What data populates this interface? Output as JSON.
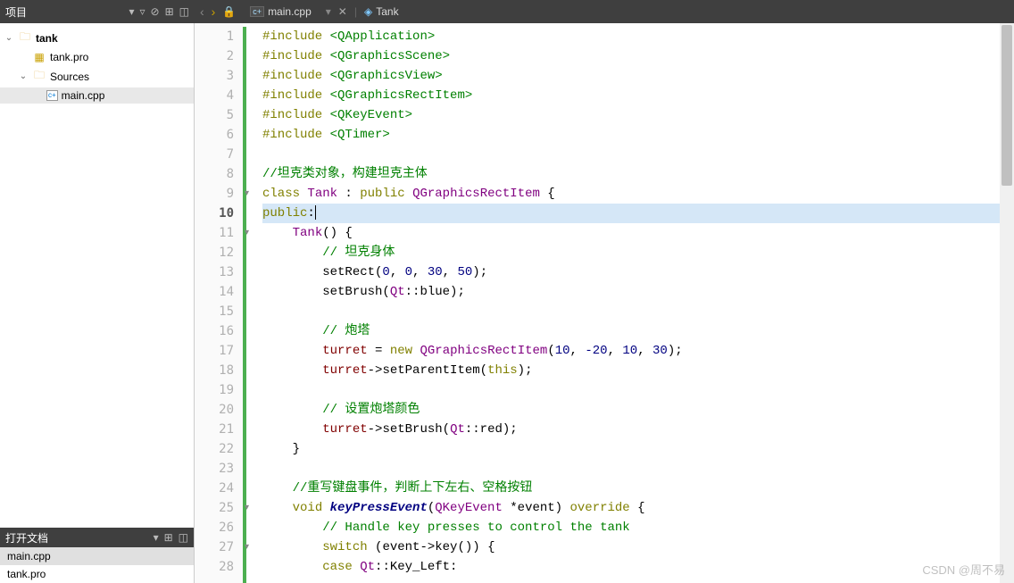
{
  "sidebar": {
    "project_label": "项目",
    "tree": {
      "root": "tank",
      "pro_file": "tank.pro",
      "sources_label": "Sources",
      "main_file": "main.cpp"
    },
    "open_docs_label": "打开文档",
    "open_docs": [
      "main.cpp",
      "tank.pro"
    ]
  },
  "tabs": {
    "current_file": "main.cpp",
    "outline_label": "Tank"
  },
  "watermark": "CSDN @周不易",
  "code_lines": [
    {
      "n": 1,
      "seg": [
        [
          "kw-olive",
          "#include"
        ],
        [
          "",
          " "
        ],
        [
          "kw-green",
          "<QApplication>"
        ]
      ]
    },
    {
      "n": 2,
      "seg": [
        [
          "kw-olive",
          "#include"
        ],
        [
          "",
          " "
        ],
        [
          "kw-green",
          "<QGraphicsScene>"
        ]
      ]
    },
    {
      "n": 3,
      "seg": [
        [
          "kw-olive",
          "#include"
        ],
        [
          "",
          " "
        ],
        [
          "kw-green",
          "<QGraphicsView>"
        ]
      ]
    },
    {
      "n": 4,
      "seg": [
        [
          "kw-olive",
          "#include"
        ],
        [
          "",
          " "
        ],
        [
          "kw-green",
          "<QGraphicsRectItem>"
        ]
      ]
    },
    {
      "n": 5,
      "seg": [
        [
          "kw-olive",
          "#include"
        ],
        [
          "",
          " "
        ],
        [
          "kw-green",
          "<QKeyEvent>"
        ]
      ]
    },
    {
      "n": 6,
      "seg": [
        [
          "kw-olive",
          "#include"
        ],
        [
          "",
          " "
        ],
        [
          "kw-green",
          "<QTimer>"
        ]
      ]
    },
    {
      "n": 7,
      "seg": []
    },
    {
      "n": 8,
      "seg": [
        [
          "comment",
          "//坦克类对象，构建坦克主体"
        ]
      ]
    },
    {
      "n": 9,
      "fold": true,
      "seg": [
        [
          "kw-olive",
          "class"
        ],
        [
          "",
          " "
        ],
        [
          "type",
          "Tank"
        ],
        [
          "",
          " : "
        ],
        [
          "kw-olive",
          "public"
        ],
        [
          "",
          " "
        ],
        [
          "type",
          "QGraphicsRectItem"
        ],
        [
          "",
          " {"
        ]
      ]
    },
    {
      "n": 10,
      "current": true,
      "seg": [
        [
          "kw-olive",
          "public"
        ],
        [
          "",
          ":"
        ],
        [
          "cursor",
          ""
        ]
      ]
    },
    {
      "n": 11,
      "fold": true,
      "seg": [
        [
          "",
          "    "
        ],
        [
          "type",
          "Tank"
        ],
        [
          "",
          "() {"
        ]
      ]
    },
    {
      "n": 12,
      "seg": [
        [
          "",
          "        "
        ],
        [
          "comment",
          "// 坦克身体"
        ]
      ]
    },
    {
      "n": 13,
      "seg": [
        [
          "",
          "        setRect("
        ],
        [
          "num",
          "0"
        ],
        [
          "",
          ", "
        ],
        [
          "num",
          "0"
        ],
        [
          "",
          ", "
        ],
        [
          "num",
          "30"
        ],
        [
          "",
          ", "
        ],
        [
          "num",
          "50"
        ],
        [
          "",
          ");"
        ]
      ]
    },
    {
      "n": 14,
      "seg": [
        [
          "",
          "        setBrush("
        ],
        [
          "type",
          "Qt"
        ],
        [
          "",
          "::blue);"
        ]
      ]
    },
    {
      "n": 15,
      "seg": []
    },
    {
      "n": 16,
      "seg": [
        [
          "",
          "        "
        ],
        [
          "comment",
          "// 炮塔"
        ]
      ]
    },
    {
      "n": 17,
      "seg": [
        [
          "",
          "        "
        ],
        [
          "ident",
          "turret"
        ],
        [
          "",
          " = "
        ],
        [
          "kw-olive",
          "new"
        ],
        [
          "",
          " "
        ],
        [
          "type",
          "QGraphicsRectItem"
        ],
        [
          "",
          "("
        ],
        [
          "num",
          "10"
        ],
        [
          "",
          ", "
        ],
        [
          "num",
          "-20"
        ],
        [
          "",
          ", "
        ],
        [
          "num",
          "10"
        ],
        [
          "",
          ", "
        ],
        [
          "num",
          "30"
        ],
        [
          "",
          ");"
        ]
      ]
    },
    {
      "n": 18,
      "seg": [
        [
          "",
          "        "
        ],
        [
          "ident",
          "turret"
        ],
        [
          "",
          "->setParentItem("
        ],
        [
          "kw-olive",
          "this"
        ],
        [
          "",
          ");"
        ]
      ]
    },
    {
      "n": 19,
      "seg": []
    },
    {
      "n": 20,
      "seg": [
        [
          "",
          "        "
        ],
        [
          "comment",
          "// 设置炮塔颜色"
        ]
      ]
    },
    {
      "n": 21,
      "seg": [
        [
          "",
          "        "
        ],
        [
          "ident",
          "turret"
        ],
        [
          "",
          "->setBrush("
        ],
        [
          "type",
          "Qt"
        ],
        [
          "",
          "::red);"
        ]
      ]
    },
    {
      "n": 22,
      "seg": [
        [
          "",
          "    }"
        ]
      ]
    },
    {
      "n": 23,
      "seg": []
    },
    {
      "n": 24,
      "seg": [
        [
          "",
          "    "
        ],
        [
          "comment",
          "//重写键盘事件，判断上下左右、空格按钮"
        ]
      ]
    },
    {
      "n": 25,
      "fold": true,
      "seg": [
        [
          "",
          "    "
        ],
        [
          "kw-olive",
          "void"
        ],
        [
          "",
          " "
        ],
        [
          "fn-ital",
          "keyPressEvent"
        ],
        [
          "",
          "("
        ],
        [
          "type",
          "QKeyEvent"
        ],
        [
          "",
          " *event) "
        ],
        [
          "kw-olive",
          "override"
        ],
        [
          "",
          " {"
        ]
      ]
    },
    {
      "n": 26,
      "seg": [
        [
          "",
          "        "
        ],
        [
          "comment",
          "// Handle key presses to control the tank"
        ]
      ]
    },
    {
      "n": 27,
      "fold": true,
      "seg": [
        [
          "",
          "        "
        ],
        [
          "kw-olive",
          "switch"
        ],
        [
          "",
          " (event->key()) {"
        ]
      ]
    },
    {
      "n": 28,
      "seg": [
        [
          "",
          "        "
        ],
        [
          "kw-olive",
          "case"
        ],
        [
          "",
          " "
        ],
        [
          "type",
          "Qt"
        ],
        [
          "",
          "::Key_Left:"
        ]
      ]
    }
  ]
}
